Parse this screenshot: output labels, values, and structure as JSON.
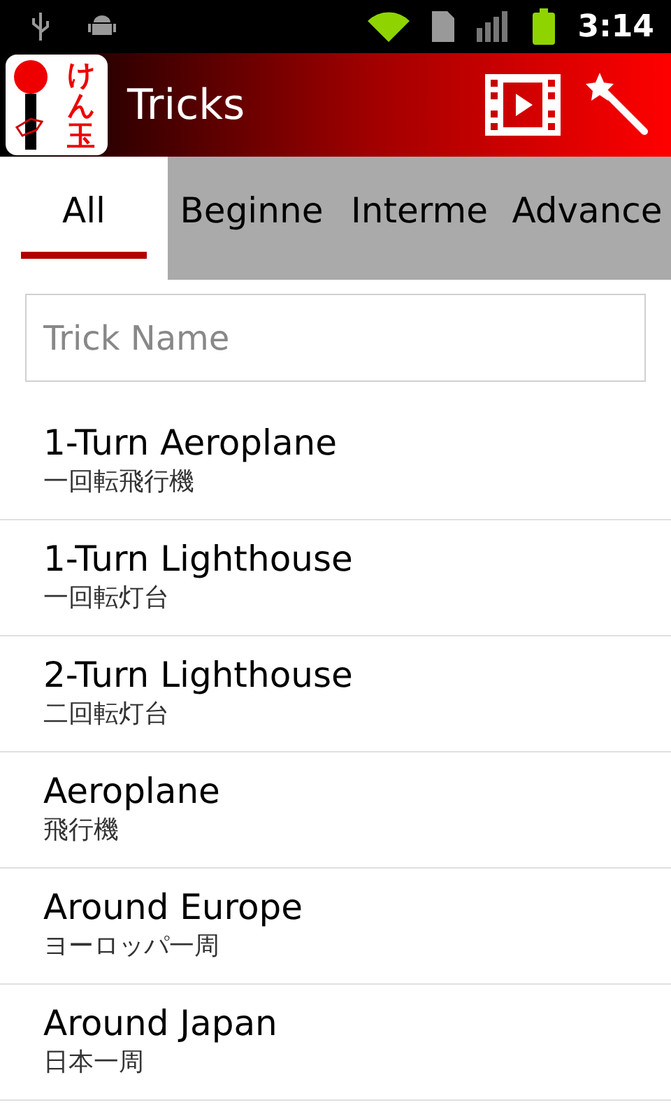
{
  "status_bar": {
    "time": "3:14"
  },
  "action_bar": {
    "logo_text": "けん玉",
    "title": "Tricks"
  },
  "tabs": [
    {
      "label": "All",
      "selected": true
    },
    {
      "label": "Beginne",
      "selected": false
    },
    {
      "label": "Interme",
      "selected": false
    },
    {
      "label": "Advance",
      "selected": false
    }
  ],
  "search": {
    "placeholder": "Trick Name"
  },
  "tricks": [
    {
      "name": "1-Turn Aeroplane",
      "japanese": "一回転飛行機"
    },
    {
      "name": "1-Turn Lighthouse",
      "japanese": "一回転灯台"
    },
    {
      "name": "2-Turn Lighthouse",
      "japanese": "二回転灯台"
    },
    {
      "name": "Aeroplane",
      "japanese": "飛行機"
    },
    {
      "name": "Around Europe",
      "japanese": "ヨーロッパ一周"
    },
    {
      "name": "Around Japan",
      "japanese": "日本一周"
    }
  ]
}
